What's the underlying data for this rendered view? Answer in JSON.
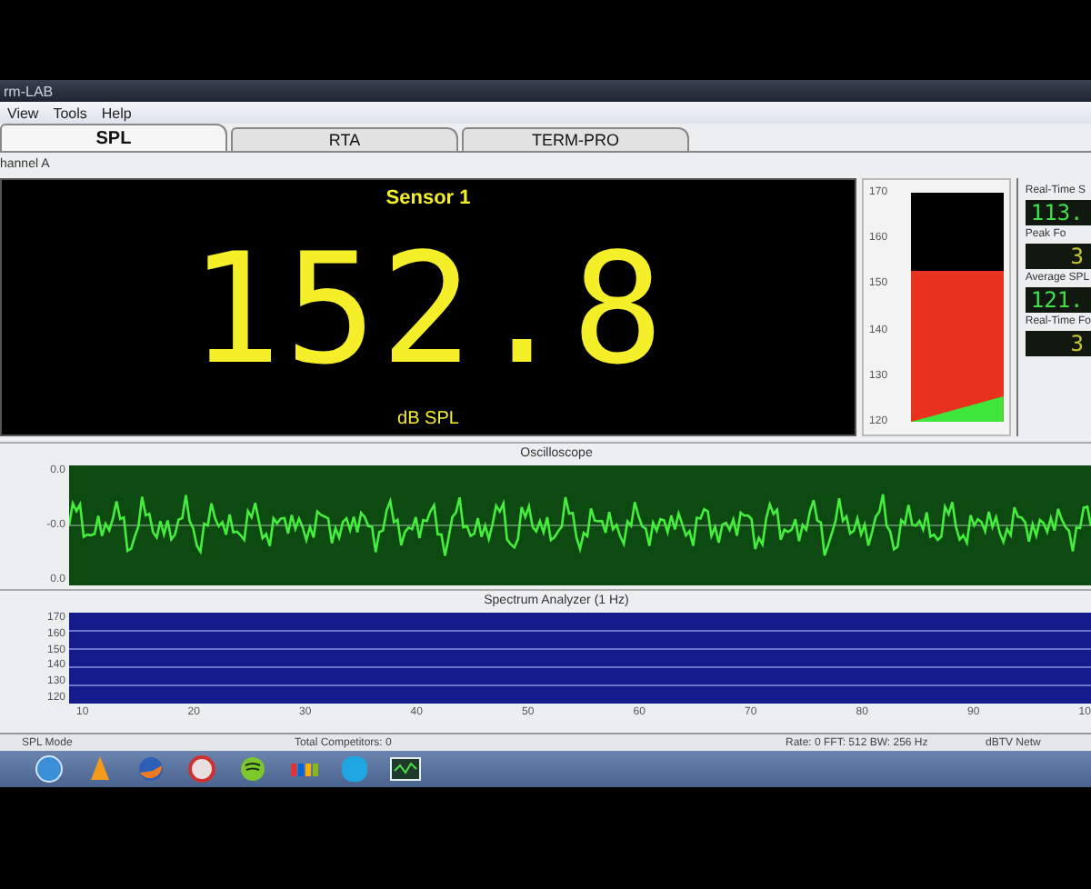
{
  "window": {
    "title": "rm-LAB"
  },
  "menu": [
    "View",
    "Tools",
    "Help"
  ],
  "tabs": [
    {
      "label": "SPL",
      "selected": true
    },
    {
      "label": "RTA",
      "selected": false
    },
    {
      "label": "TERM-PRO",
      "selected": false
    }
  ],
  "channel": "hannel A",
  "display": {
    "sensor": "Sensor 1",
    "value": "152.8",
    "unit": "dB SPL"
  },
  "gauge": {
    "ticks": [
      "170",
      "160",
      "150",
      "140",
      "130",
      "120"
    ],
    "level": 0.66
  },
  "readouts": [
    {
      "label": "Real-Time S",
      "value": "113.",
      "kind": "green"
    },
    {
      "label": "Peak Fo",
      "value": "3",
      "kind": "amber"
    },
    {
      "label": "Average SPL",
      "value": "121.",
      "kind": "green"
    },
    {
      "label": "Real-Time Fo",
      "value": "3",
      "kind": "amber"
    }
  ],
  "oscilloscope": {
    "title": "Oscilloscope",
    "ticks": [
      "0.0",
      "-0.0",
      "0.0"
    ]
  },
  "spectrum": {
    "title": "Spectrum Analyzer (1 Hz)",
    "yticks": [
      "170",
      "160",
      "150",
      "140",
      "130",
      "120"
    ],
    "xticks": [
      "10",
      "20",
      "30",
      "40",
      "50",
      "60",
      "70",
      "80",
      "90",
      "10"
    ]
  },
  "status_bar": [
    "SPL Mode",
    "Total Competitors: 0",
    "Rate: 0 FFT: 512 BW: 256 Hz",
    "dBTV Netw"
  ]
}
